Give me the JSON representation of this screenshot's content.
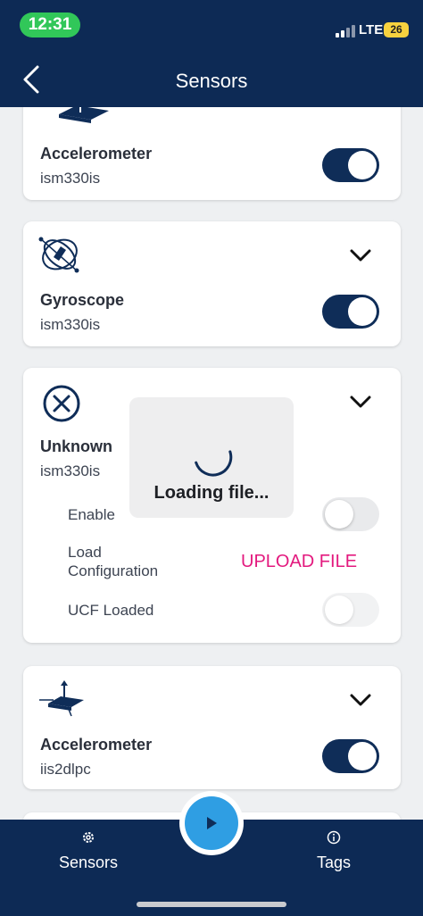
{
  "status": {
    "time": "12:31",
    "network": "LTE",
    "battery": "26"
  },
  "nav": {
    "title": "Sensors"
  },
  "cards": [
    {
      "icon": "accelerometer-icon",
      "title": "Accelerometer",
      "model": "ism330is",
      "enabled": true
    },
    {
      "icon": "gyroscope-icon",
      "title": "Gyroscope",
      "model": "ism330is",
      "enabled": true
    },
    {
      "icon": "close-circle-icon",
      "title": "Unknown",
      "model": "ism330is",
      "enabled": false,
      "rows": {
        "enable": "Enable",
        "load_config_line1": "Load",
        "load_config_line2": "Configuration",
        "upload": "UPLOAD FILE",
        "ucf_loaded": "UCF Loaded"
      }
    },
    {
      "icon": "accelerometer-icon",
      "title": "Accelerometer",
      "model": "iis2dlpc",
      "enabled": true
    }
  ],
  "loading": {
    "text": "Loading file..."
  },
  "tabs": [
    {
      "label": "Sensors",
      "icon": "gear-icon"
    },
    {
      "label": "Tags",
      "icon": "info-icon"
    }
  ],
  "colors": {
    "navy": "#0d2a55",
    "accent": "#2f9ee3",
    "upload": "#e3197e",
    "status_green": "#31c759"
  }
}
